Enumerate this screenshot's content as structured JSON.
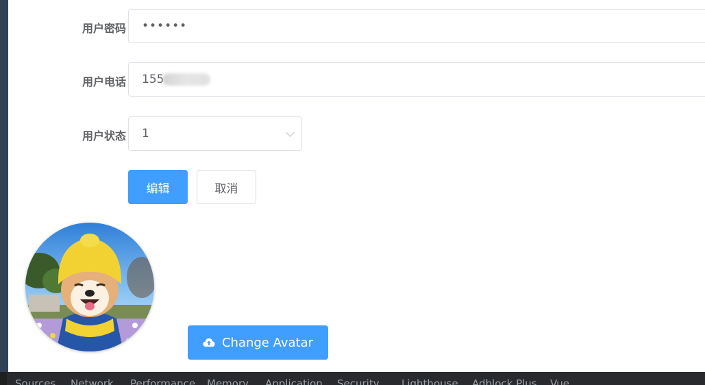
{
  "form": {
    "password_label": "用户密码",
    "password_value": "••••••",
    "phone_label": "用户电话",
    "phone_value": "155",
    "status_label": "用户状态",
    "status_value": "1"
  },
  "actions": {
    "edit_label": "编辑",
    "cancel_label": "取消"
  },
  "avatar": {
    "upload_label": "Change Avatar",
    "upload_icon": "cloud-upload-icon"
  },
  "devtools": {
    "tabs": [
      "Sources",
      "Network",
      "Performance",
      "Memory",
      "Application",
      "Security",
      "Lighthouse",
      "Adblock Plus",
      "Vue"
    ]
  },
  "colors": {
    "primary": "#409eff",
    "sidebar": "#304156",
    "devtools_bg": "#292a2d"
  }
}
